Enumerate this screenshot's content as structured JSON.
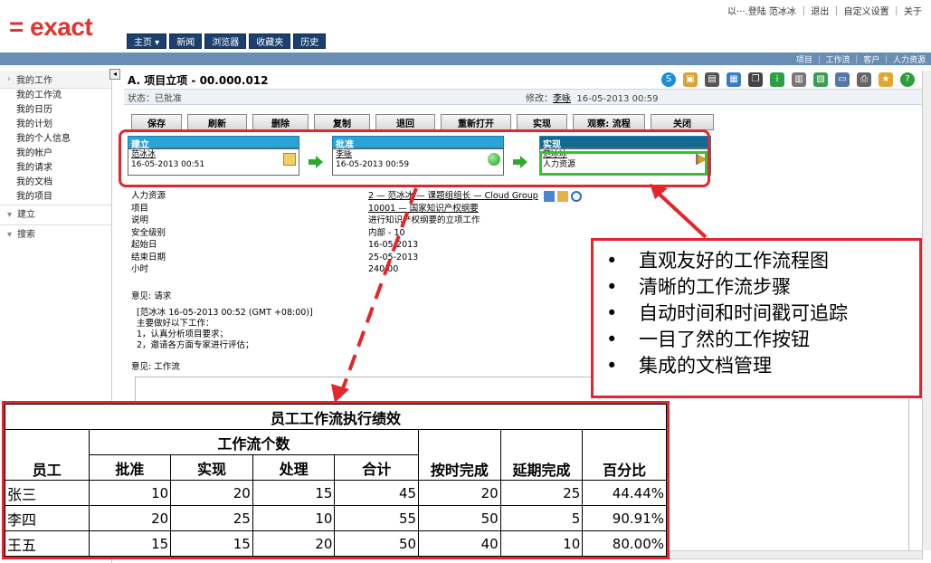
{
  "colors": {
    "accent_red": "#e3262b",
    "nav_blue": "#1b3f6e",
    "bar_blue": "#6a8db3",
    "step_blue": "#2aa3d6",
    "green": "#33c233"
  },
  "header": {
    "logo": "= exact",
    "top_links": "以···.登陆 范冰冰 ｜ 退出 ｜ 自定义设置 ｜ 关于",
    "nav": [
      {
        "label": "主页 ▾"
      },
      {
        "label": "新闻"
      },
      {
        "label": "浏览器"
      },
      {
        "label": "收藏夹"
      },
      {
        "label": "历史"
      }
    ],
    "bar_links": "项目 ｜ 工作流 ｜ 客户 ｜ 人力资源"
  },
  "sidebar": {
    "head": "我的工作",
    "items": [
      "我的工作流",
      "我的日历",
      "我的计划",
      "我的个人信息",
      "我的帐户",
      "我的请求",
      "我的文档",
      "我的项目"
    ],
    "groups": [
      "建立",
      "搜索"
    ]
  },
  "main": {
    "title": "A. 项目立项  - 00.000.012",
    "status": "状态：已批准",
    "modify_label": "修改：",
    "modify_user": "李咏",
    "modify_time": "16-05-2013 00:59",
    "buttons": [
      "保存",
      "刷新",
      "删除",
      "复制",
      "退回",
      "重新打开",
      "实现",
      "观察: 流程",
      "关闭"
    ],
    "workflow": [
      {
        "head": "建立",
        "user": "范冰冰",
        "time": "16-05-2013 00:51"
      },
      {
        "head": "批准",
        "user": "李咏",
        "time": "16-05-2013 00:59"
      },
      {
        "head": "实现",
        "user": "范冰冰",
        "time": "人力资源"
      }
    ],
    "field_labels": [
      "人力资源",
      "项目",
      "说明",
      "安全级别",
      "起始日",
      "结束日期",
      "小时"
    ],
    "field_values": {
      "hr": "2 — 范冰冰  —  课题组组长  —  Cloud Group",
      "project": "10001 — 国家知识产权纲要",
      "desc": "进行知识产权纲要的立项工作",
      "security": "内部 - 10",
      "start": "16-05-2013",
      "end": "25-05-2013",
      "hours": "240.00"
    },
    "comment_label": "意见: 请求",
    "comment_lines": [
      "[范冰冰  16-05-2013 00:52 (GMT +08:00)]",
      "主要做好以下工作：",
      "1，认真分析项目要求；",
      "2，邀请各方面专家进行评估；"
    ],
    "comment2_label": "意见: 工作流"
  },
  "callout": {
    "bullets": [
      "直观友好的工作流程图",
      "清晰的工作流步骤",
      "自动时间和时间戳可追踪",
      "一目了然的工作按钮",
      "集成的文档管理"
    ]
  },
  "perf_table": {
    "title": "员工工作流执行绩效",
    "group_header": "工作流个数",
    "headers": [
      "员工",
      "批准",
      "实现",
      "处理",
      "合计",
      "按时完成",
      "延期完成",
      "百分比"
    ],
    "rows": [
      [
        "张三",
        "10",
        "20",
        "15",
        "45",
        "20",
        "25",
        "44.44%"
      ],
      [
        "李四",
        "20",
        "25",
        "10",
        "55",
        "50",
        "5",
        "90.91%"
      ],
      [
        "王五",
        "15",
        "15",
        "20",
        "50",
        "40",
        "10",
        "80.00%"
      ]
    ]
  }
}
